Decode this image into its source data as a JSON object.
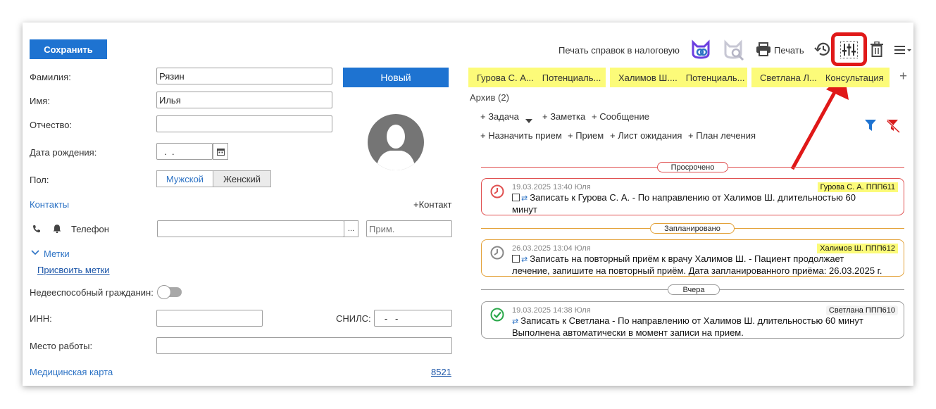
{
  "toolbar": {
    "save_label": "Сохранить",
    "tax_print_label": "Печать справок в налоговую",
    "print_label": "Печать"
  },
  "form": {
    "surname_label": "Фамилия:",
    "surname_value": "Рязин",
    "name_label": "Имя:",
    "name_value": "Илья",
    "patronymic_label": "Отчество:",
    "patronymic_value": "",
    "birthdate_label": "Дата рождения:",
    "birthdate_value": "  .  .",
    "gender_label": "Пол:",
    "gender_options": [
      "Мужской",
      "Женский"
    ],
    "status_label": "Новый",
    "contacts_label": "Контакты",
    "add_contact_label": "+Контакт",
    "phone_label": "Телефон",
    "phone_value": "",
    "phone_note_placeholder": "Прим.",
    "ellipsis": "...",
    "tags_label": "Метки",
    "assign_tags_label": "Присвоить метки",
    "incapable_label": "Недееспособный гражданин:",
    "inn_label": "ИНН:",
    "inn_value": "",
    "snils_label": "СНИЛС:",
    "snils_value": "   -   -",
    "workplace_label": "Место работы:",
    "workplace_value": "",
    "medcard_label": "Медицинская карта",
    "medcard_value": "8521"
  },
  "tabs": [
    {
      "name": "Гурова С. А...",
      "status": "Потенциаль..."
    },
    {
      "name": "Халимов Ш....",
      "status": "Потенциаль..."
    },
    {
      "name": "Светлана Л...",
      "status": "Консультация"
    }
  ],
  "add_tab_label": "+",
  "archive_label": "Архив (2)",
  "actions_row1": [
    "+ Задача",
    "+ Заметка",
    "+ Сообщение"
  ],
  "actions_row2": [
    "+ Назначить прием",
    "+ Прием",
    "+ Лист ожидания",
    "+ План лечения"
  ],
  "sections": {
    "overdue": "Просрочено",
    "planned": "Запланировано",
    "yesterday": "Вчера"
  },
  "events": [
    {
      "meta": "19.03.2025 13:40 Юля",
      "tag": "Гурова С. А. ППП611",
      "text": "Записать к Гурова С. А. - По направлению от Халимов Ш. длительностью 60 минут",
      "line1": "Записать к Гурова С. А. - По направлению от Халимов Ш. длительностью 60",
      "line2": "минут"
    },
    {
      "meta": "26.03.2025 13:04 Юля",
      "tag": "Халимов Ш. ППП612",
      "line1": "Записать на повторный приём к врачу Халимов Ш. - Пациент продолжает",
      "line2": "лечение, запишите на повторный приём. Дата запланированного приёма: 26.03.2025 г."
    },
    {
      "meta": "19.03.2025 14:38 Юля",
      "tag": "Светлана ППП610",
      "line1": "Записать к Светлана - По направлению от Халимов Ш. длительностью 60 минут",
      "line2": "Выполнена автоматически в момент записи на прием."
    }
  ],
  "colors": {
    "primary": "#1e73d1",
    "tab_bg": "#fcfb79",
    "overdue": "#e05050",
    "planned": "#e3a23a",
    "done": "#2aa84a",
    "highlight": "#e01818"
  }
}
